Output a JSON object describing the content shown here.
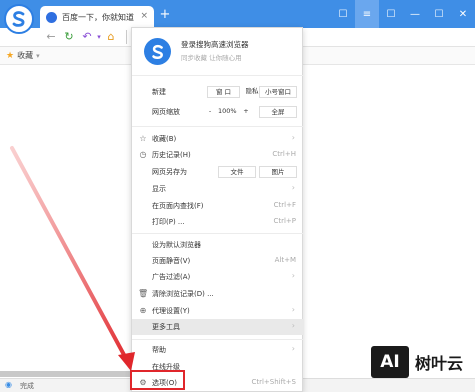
{
  "tab": {
    "title": "百度一下，你就知道",
    "close": "×",
    "new_tab": "+"
  },
  "titlebar_icons": [
    "≡",
    "☐",
    "—",
    "☐",
    "✕"
  ],
  "nav": {
    "back": "←",
    "forward": "→",
    "reload": "↻",
    "undo": "↶",
    "home": "⌂"
  },
  "bookmarks": {
    "label": "收藏",
    "dropdown": "▾"
  },
  "status": {
    "text": "完成"
  },
  "menu": {
    "login": "登录搜狗高速浏览器",
    "sync": "同步收藏 让你随心用",
    "new_label": "新建",
    "new_window": "窗 口",
    "incognito": "隐私窗口",
    "mini_window": "小号窗口",
    "zoom_label": "网页缩放",
    "zoom_minus": "-",
    "zoom_value": "100%",
    "zoom_plus": "+",
    "fullscreen": "全屏",
    "favorites": "收藏(B)",
    "history": "历史记录(H)",
    "history_sc": "Ctrl+H",
    "save_as": "网页另存为",
    "save_file": "文件",
    "save_image": "图片",
    "display": "显示",
    "find": "在页面内查找(F)",
    "find_sc": "Ctrl+F",
    "print": "打印(P) ...",
    "print_sc": "Ctrl+P",
    "set_default": "设为默认浏览器",
    "mute": "页面静音(V)",
    "mute_sc": "Alt+M",
    "adblock": "广告过滤(A)",
    "clear": "清除浏览记录(D) ...",
    "proxy": "代理设置(Y)",
    "more_tools": "更多工具",
    "help": "帮助",
    "upgrade": "在线升级",
    "options": "选项(O)",
    "options_sc": "Ctrl+Shift+S",
    "arrow": "›"
  },
  "watermark": {
    "logo": "AI",
    "text": "树叶云"
  }
}
